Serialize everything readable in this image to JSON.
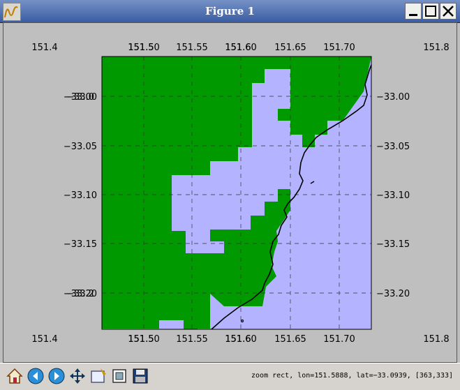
{
  "window": {
    "title": "Figure 1",
    "app_icon": "matplotlib-waveform-icon"
  },
  "window_controls": [
    "minimize-icon",
    "maximize-icon",
    "close-icon"
  ],
  "figure": {
    "lon_ticks_outer": [
      "151.4",
      "151.8"
    ],
    "lon_ticks_inner": [
      "151.50",
      "151.55",
      "151.60",
      "151.65",
      "151.70"
    ],
    "lon_ticks_overlap": [
      "151.5",
      "151.6"
    ],
    "lat_ticks_left": [
      "−33.00",
      "−33.05",
      "−33.10",
      "−33.15",
      "−33.20"
    ],
    "lat_ticks_right": [
      "−33.00",
      "−33.05",
      "−33.10",
      "−33.15",
      "−33.20"
    ],
    "lat_ticks_overlap": [
      "−33.0",
      "−33.2"
    ],
    "colors": {
      "land": "#009900",
      "water": "#b3b3ff",
      "coastline": "#000000",
      "grid": "#333333"
    }
  },
  "toolbar": {
    "tools": [
      "home-icon",
      "back-icon",
      "forward-icon",
      "pan-icon",
      "zoom-rect-icon",
      "subplots-icon",
      "save-icon"
    ],
    "status": "zoom rect, lon=151.5888, lat=−33.0939, [363,333]"
  }
}
